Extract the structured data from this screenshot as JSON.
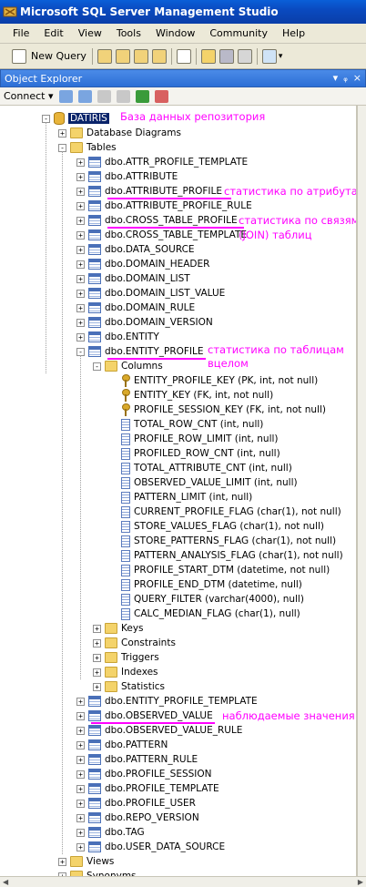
{
  "window": {
    "title": "Microsoft SQL Server Management Studio"
  },
  "menu": [
    "File",
    "Edit",
    "View",
    "Tools",
    "Window",
    "Community",
    "Help"
  ],
  "toolbar": {
    "new_query": "New Query"
  },
  "object_explorer": {
    "title": "Object Explorer",
    "pin": "▾ ⊐ ×",
    "connect": "Connect ▾"
  },
  "tree": {
    "db": "DATIRIS",
    "db_diagrams": "Database Diagrams",
    "tables": "Tables",
    "table_list_a": [
      "dbo.ATTR_PROFILE_TEMPLATE",
      "dbo.ATTRIBUTE",
      "dbo.ATTRIBUTE_PROFILE",
      "dbo.ATTRIBUTE_PROFILE_RULE",
      "dbo.CROSS_TABLE_PROFILE",
      "dbo.CROSS_TABLE_TEMPLATE",
      "dbo.DATA_SOURCE",
      "dbo.DOMAIN_HEADER",
      "dbo.DOMAIN_LIST",
      "dbo.DOMAIN_LIST_VALUE",
      "dbo.DOMAIN_RULE",
      "dbo.DOMAIN_VERSION",
      "dbo.ENTITY",
      "dbo.ENTITY_PROFILE"
    ],
    "columns": "Columns",
    "column_list": [
      {
        "name": "ENTITY_PROFILE_KEY (PK, int, not null)",
        "icon": "key"
      },
      {
        "name": "ENTITY_KEY (FK, int, not null)",
        "icon": "key"
      },
      {
        "name": "PROFILE_SESSION_KEY (FK, int, not null)",
        "icon": "key"
      },
      {
        "name": "TOTAL_ROW_CNT (int, null)",
        "icon": "col"
      },
      {
        "name": "PROFILE_ROW_LIMIT (int, null)",
        "icon": "col"
      },
      {
        "name": "PROFILED_ROW_CNT (int, null)",
        "icon": "col"
      },
      {
        "name": "TOTAL_ATTRIBUTE_CNT (int, null)",
        "icon": "col"
      },
      {
        "name": "OBSERVED_VALUE_LIMIT (int, null)",
        "icon": "col"
      },
      {
        "name": "PATTERN_LIMIT (int, null)",
        "icon": "col"
      },
      {
        "name": "CURRENT_PROFILE_FLAG (char(1), not null)",
        "icon": "col"
      },
      {
        "name": "STORE_VALUES_FLAG (char(1), not null)",
        "icon": "col"
      },
      {
        "name": "STORE_PATTERNS_FLAG (char(1), not null)",
        "icon": "col"
      },
      {
        "name": "PATTERN_ANALYSIS_FLAG (char(1), not null)",
        "icon": "col"
      },
      {
        "name": "PROFILE_START_DTM (datetime, not null)",
        "icon": "col"
      },
      {
        "name": "PROFILE_END_DTM (datetime, null)",
        "icon": "col"
      },
      {
        "name": "QUERY_FILTER (varchar(4000), null)",
        "icon": "col"
      },
      {
        "name": "CALC_MEDIAN_FLAG (char(1), null)",
        "icon": "col"
      }
    ],
    "sub_folders": [
      "Keys",
      "Constraints",
      "Triggers",
      "Indexes",
      "Statistics"
    ],
    "table_list_b": [
      "dbo.ENTITY_PROFILE_TEMPLATE",
      "dbo.OBSERVED_VALUE",
      "dbo.OBSERVED_VALUE_RULE",
      "dbo.PATTERN",
      "dbo.PATTERN_RULE",
      "dbo.PROFILE_SESSION",
      "dbo.PROFILE_TEMPLATE",
      "dbo.PROFILE_USER",
      "dbo.REPO_VERSION",
      "dbo.TAG",
      "dbo.USER_DATA_SOURCE"
    ],
    "views": "Views",
    "synonyms": "Synonyms"
  },
  "annotations": {
    "db": "База данных  репозитория",
    "attribute_profile": "статистика по атрибутам",
    "cross_table_1": "статистика по связям",
    "cross_table_2": "(JOIN) таблиц",
    "entity_profile_1": "статистика по таблицам",
    "entity_profile_2": "вцелом",
    "observed_value": "наблюдаемые значения"
  },
  "colors": {
    "annotation": "#ff00ff",
    "title_bar": "#0a4ac0",
    "selection": "#0a246a"
  }
}
